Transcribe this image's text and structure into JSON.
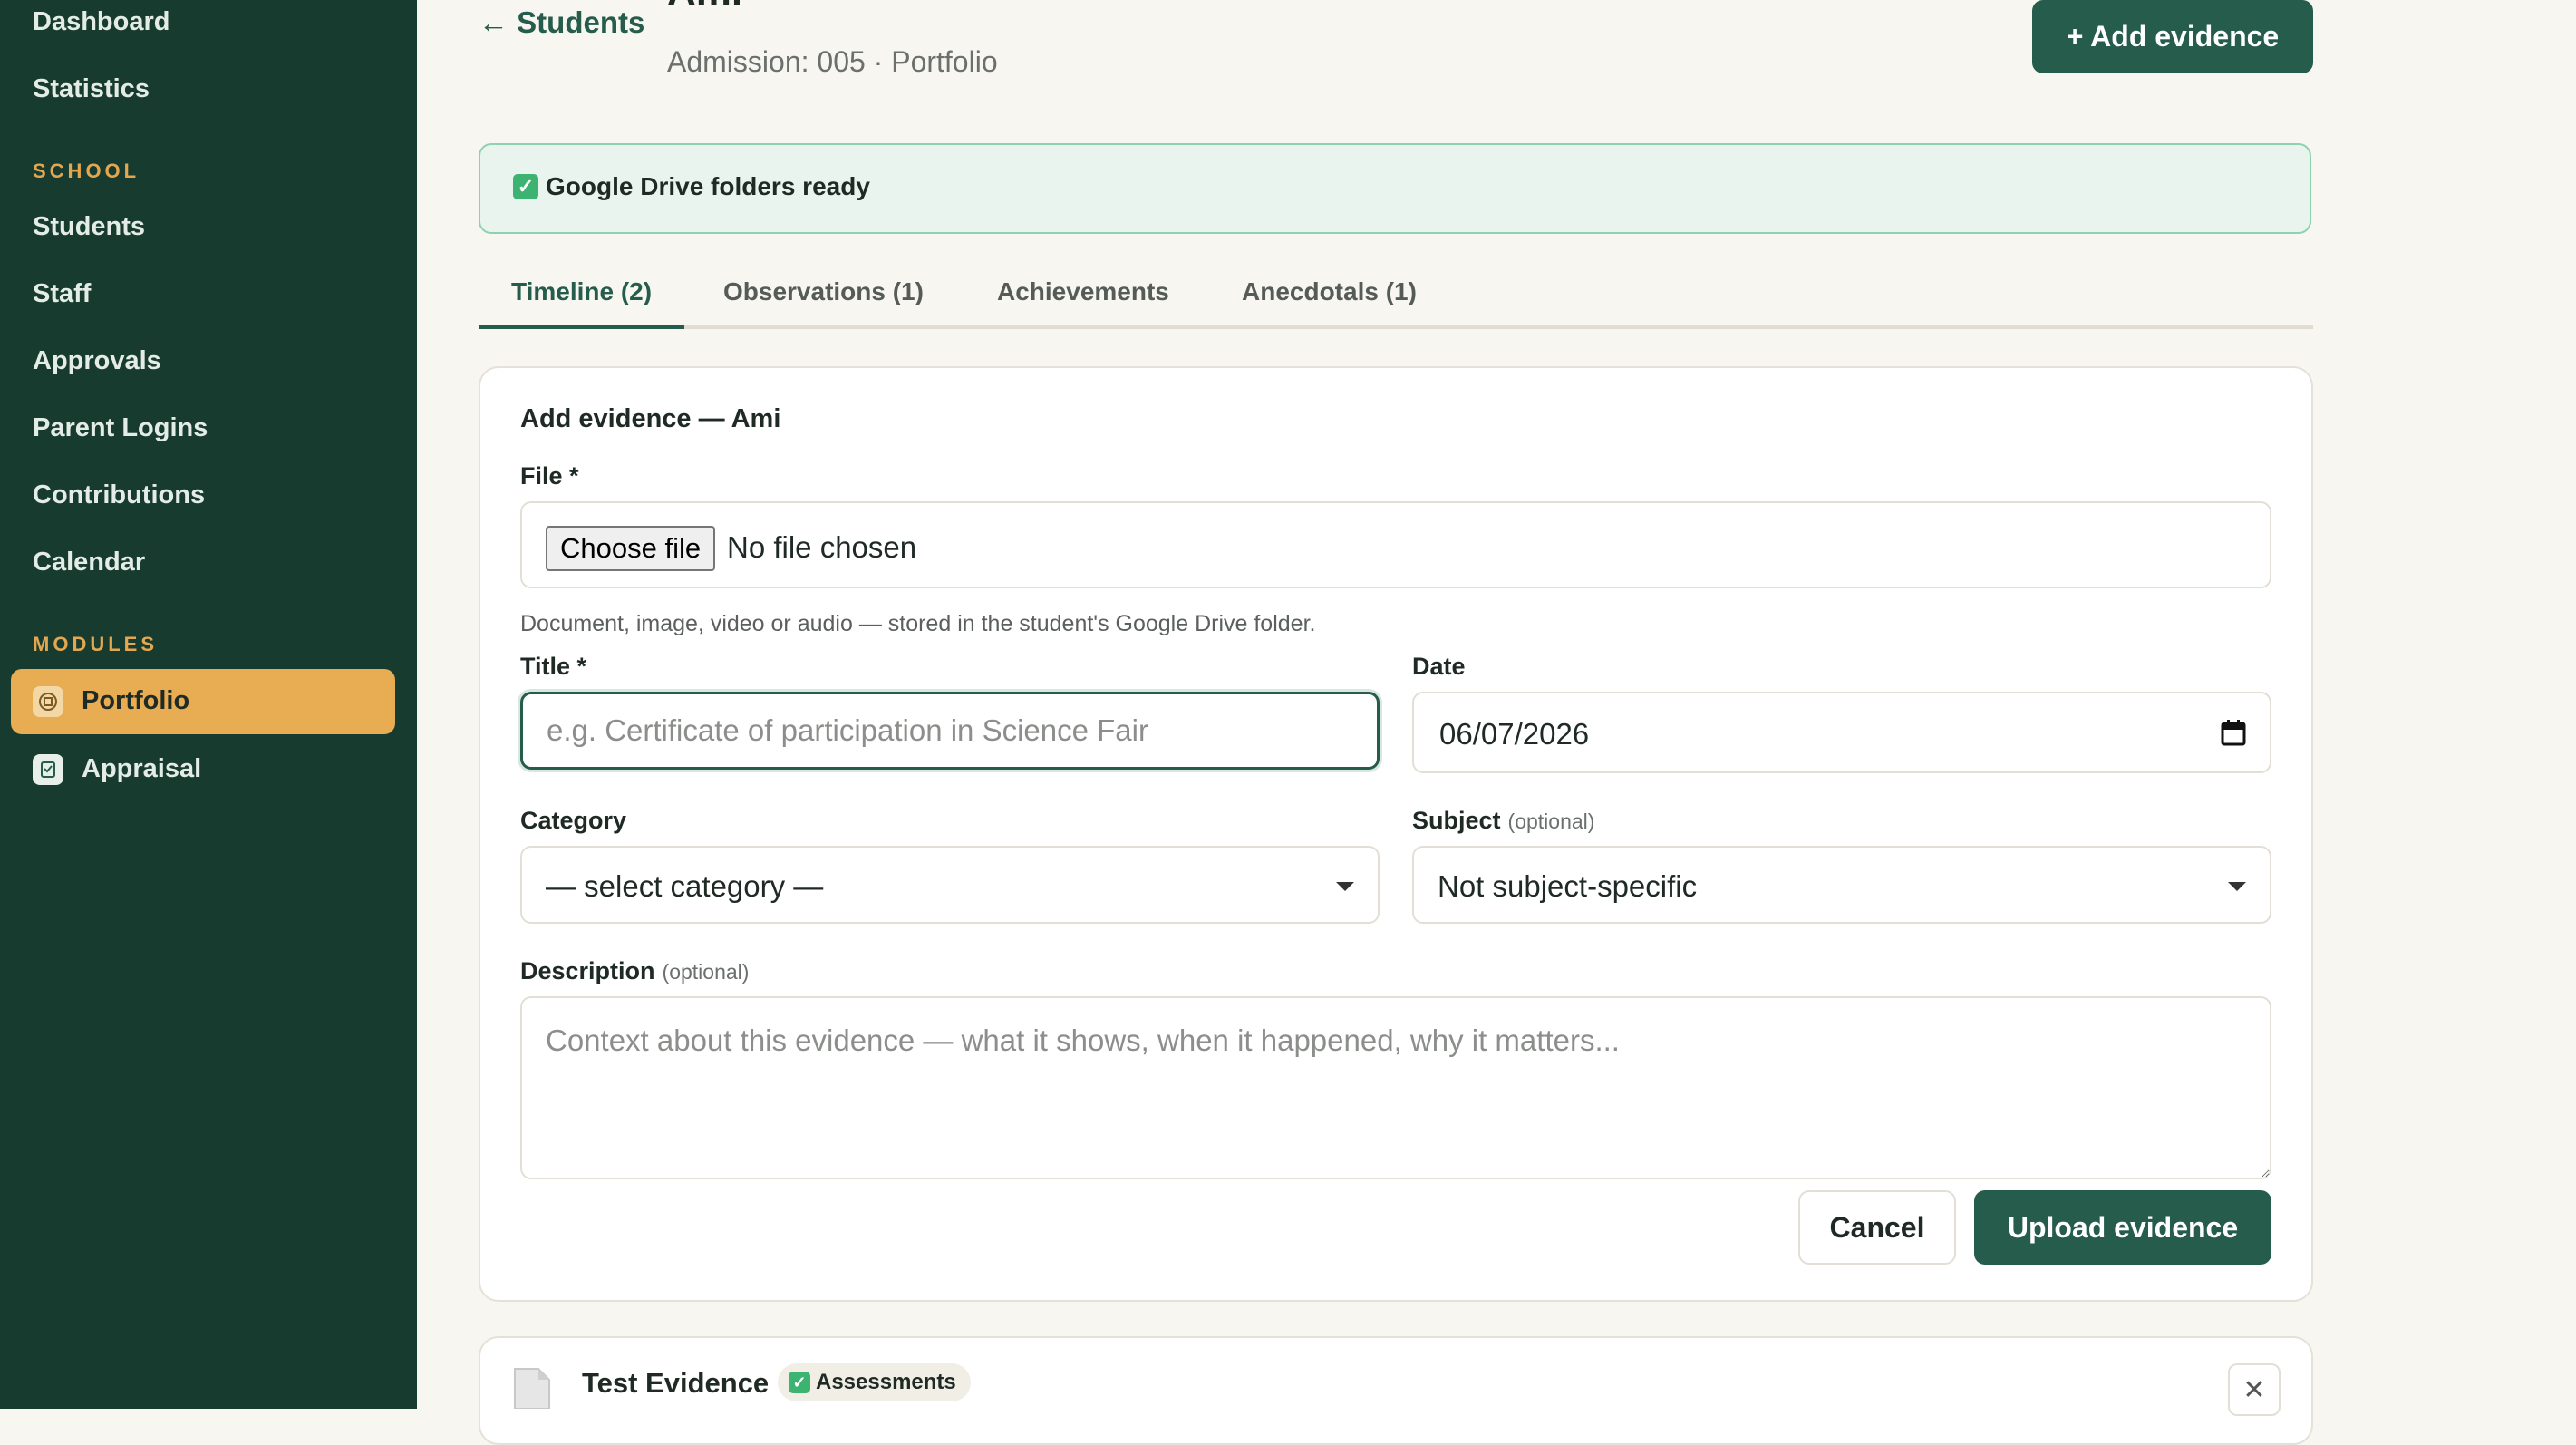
{
  "sidebar": {
    "items_top": [
      {
        "label": "Dashboard"
      },
      {
        "label": "Statistics"
      }
    ],
    "section_school": "SCHOOL",
    "items_school": [
      {
        "label": "Students"
      },
      {
        "label": "Staff"
      },
      {
        "label": "Approvals"
      },
      {
        "label": "Parent Logins"
      },
      {
        "label": "Contributions"
      },
      {
        "label": "Calendar"
      }
    ],
    "section_modules": "MODULES",
    "items_modules": [
      {
        "label": "Portfolio",
        "icon": "portfolio-icon",
        "active": true
      },
      {
        "label": "Appraisal",
        "icon": "appraisal-icon",
        "active": false
      }
    ]
  },
  "header": {
    "back_label": "Students",
    "back_icon": "arrow-left-icon",
    "student_name": "Ami",
    "subline": "Admission: 005 · Portfolio",
    "add_button": "+ Add evidence"
  },
  "banner": {
    "text": "Google Drive folders ready",
    "icon": "check-icon"
  },
  "tabs": [
    {
      "label": "Timeline (2)",
      "active": true
    },
    {
      "label": "Observations (1)",
      "active": false
    },
    {
      "label": "Achievements",
      "active": false
    },
    {
      "label": "Anecdotals (1)",
      "active": false
    }
  ],
  "form": {
    "title": "Add evidence — Ami",
    "file_label": "File *",
    "choose_file": "Choose file",
    "no_file": "No file chosen",
    "file_hint": "Document, image, video or audio — stored in the student's Google Drive folder.",
    "title_label": "Title *",
    "title_placeholder": "e.g. Certificate of participation in Science Fair",
    "date_label": "Date",
    "date_value": "06/07/2026",
    "category_label": "Category",
    "category_value": "— select category —",
    "subject_label": "Subject",
    "subject_optional": "(optional)",
    "subject_value": "Not subject-specific",
    "description_label": "Description",
    "description_optional": "(optional)",
    "description_placeholder": "Context about this evidence — what it shows, when it happened, why it matters...",
    "cancel": "Cancel",
    "upload": "Upload evidence"
  },
  "evidence_item": {
    "title": "Test Evidence",
    "badge": "Assessments",
    "close_icon": "close-icon"
  },
  "colors": {
    "sidebar_bg": "#183b2f",
    "accent": "#255c4b",
    "active_nav": "#e8ad52",
    "section_label": "#e3a74f",
    "banner_bg": "#e9f4ee"
  }
}
